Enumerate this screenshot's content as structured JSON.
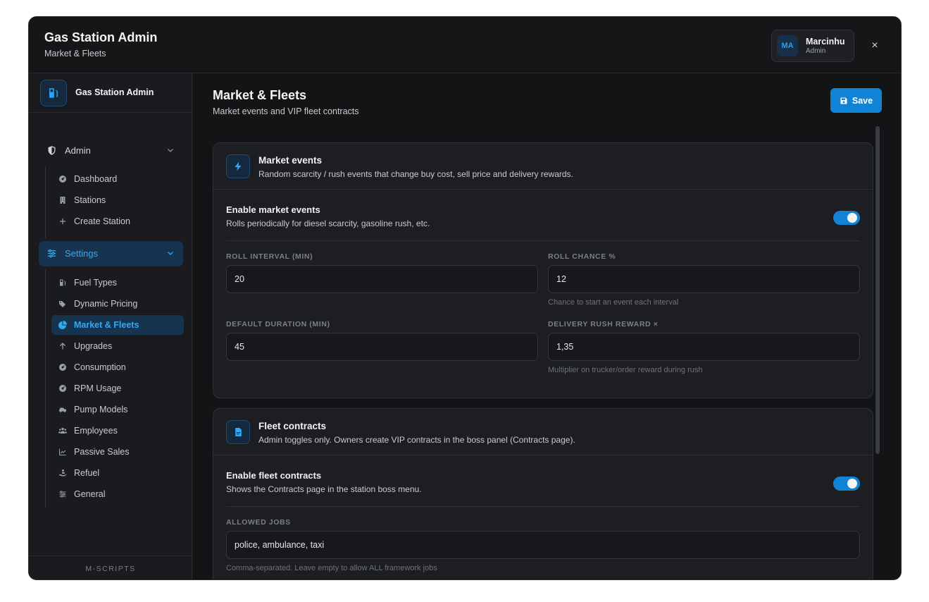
{
  "header": {
    "title": "Gas Station Admin",
    "subtitle": "Market & Fleets",
    "user": {
      "initials": "MA",
      "name": "Marcinhu",
      "role": "Admin"
    },
    "close_label": "×"
  },
  "sidebar": {
    "brand": "Gas Station Admin",
    "groups": [
      {
        "label": "Admin",
        "icon": "shield-icon",
        "items": [
          {
            "label": "Dashboard",
            "icon": "gauge-icon"
          },
          {
            "label": "Stations",
            "icon": "building-icon"
          },
          {
            "label": "Create Station",
            "icon": "plus-icon"
          }
        ]
      },
      {
        "label": "Settings",
        "icon": "sliders-icon",
        "items": [
          {
            "label": "Fuel Types",
            "icon": "fuel-pump-icon"
          },
          {
            "label": "Dynamic Pricing",
            "icon": "tag-icon"
          },
          {
            "label": "Market & Fleets",
            "icon": "pie-chart-icon",
            "active": true
          },
          {
            "label": "Upgrades",
            "icon": "arrow-up-icon"
          },
          {
            "label": "Consumption",
            "icon": "gauge-icon"
          },
          {
            "label": "RPM Usage",
            "icon": "gauge-icon"
          },
          {
            "label": "Pump Models",
            "icon": "car-icon"
          },
          {
            "label": "Employees",
            "icon": "users-icon"
          },
          {
            "label": "Passive Sales",
            "icon": "chart-line-icon"
          },
          {
            "label": "Refuel",
            "icon": "hand-icon"
          },
          {
            "label": "General",
            "icon": "sliders-icon"
          }
        ]
      }
    ],
    "footer": "M-SCRIPTS"
  },
  "main": {
    "title": "Market & Fleets",
    "subtitle": "Market events and VIP fleet contracts",
    "save_label": "Save",
    "market": {
      "title": "Market events",
      "desc": "Random scarcity / rush events that change buy cost, sell price and delivery rewards.",
      "toggle_title": "Enable market events",
      "toggle_desc": "Rolls periodically for diesel scarcity, gasoline rush, etc.",
      "enabled": true,
      "fields": {
        "roll_interval": {
          "label": "ROLL INTERVAL (MIN)",
          "value": "20"
        },
        "roll_chance": {
          "label": "ROLL CHANCE %",
          "value": "12",
          "help": "Chance to start an event each interval"
        },
        "default_duration": {
          "label": "DEFAULT DURATION (MIN)",
          "value": "45"
        },
        "rush_reward": {
          "label": "DELIVERY RUSH REWARD ×",
          "value": "1,35",
          "help": "Multiplier on trucker/order reward during rush"
        }
      }
    },
    "fleet": {
      "title": "Fleet contracts",
      "desc": "Admin toggles only. Owners create VIP contracts in the boss panel (Contracts page).",
      "toggle_title": "Enable fleet contracts",
      "toggle_desc": "Shows the Contracts page in the station boss menu.",
      "enabled": true,
      "allowed_jobs": {
        "label": "ALLOWED JOBS",
        "value": "police, ambulance, taxi",
        "help": "Comma-separated. Leave empty to allow ALL framework jobs"
      }
    }
  },
  "colors": {
    "accent": "#1083d6",
    "accent_text": "#35a8f5",
    "background": "#131416",
    "panel": "#1d1e21"
  }
}
